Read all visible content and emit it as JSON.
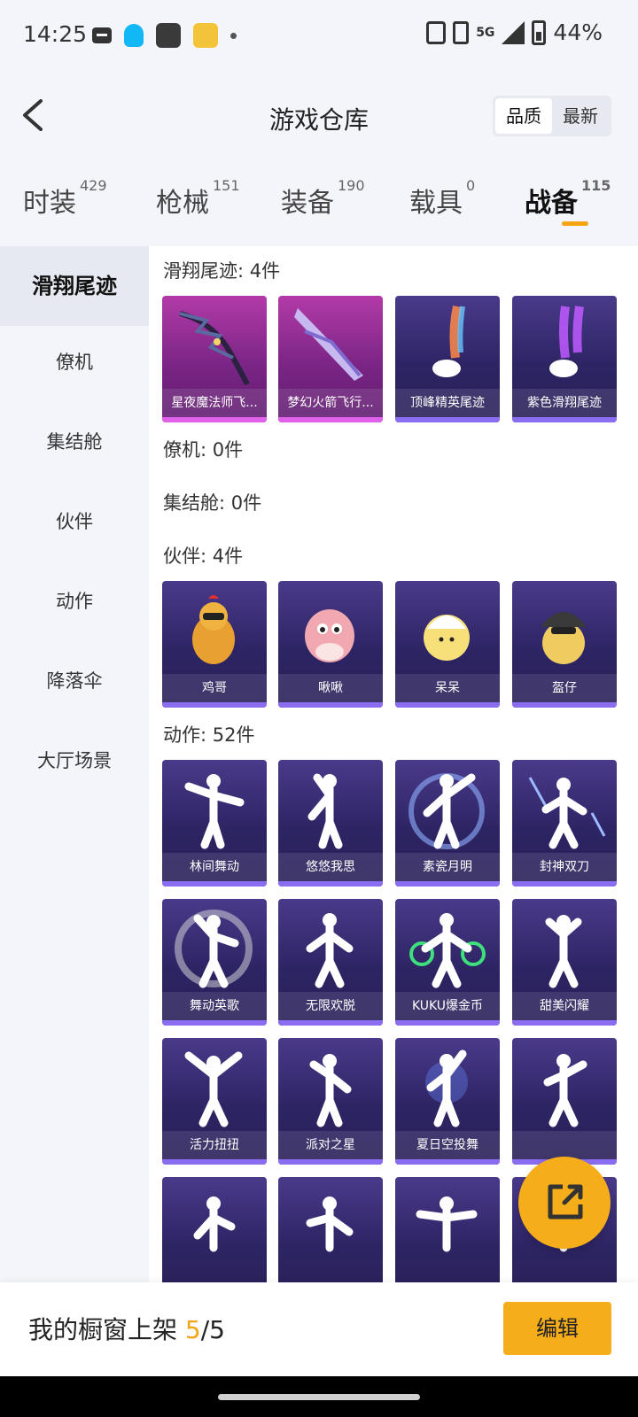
{
  "status_bar": {
    "time": "14:25",
    "network": "5G",
    "battery": "44%"
  },
  "header": {
    "title": "游戏仓库",
    "sort_options": [
      "品质",
      "最新"
    ],
    "active_sort": "品质"
  },
  "tabs": [
    {
      "label": "时装",
      "count": "429"
    },
    {
      "label": "枪械",
      "count": "151"
    },
    {
      "label": "装备",
      "count": "190"
    },
    {
      "label": "载具",
      "count": "0"
    },
    {
      "label": "战备",
      "count": "115",
      "active": true
    }
  ],
  "sidebar": {
    "items": [
      {
        "label": "滑翔尾迹",
        "active": true
      },
      {
        "label": "僚机"
      },
      {
        "label": "集结舱"
      },
      {
        "label": "伙伴"
      },
      {
        "label": "动作"
      },
      {
        "label": "降落伞"
      },
      {
        "label": "大厅场景"
      }
    ]
  },
  "sections": [
    {
      "title": "滑翔尾迹: 4件",
      "items": [
        "星夜魔法师飞...",
        "梦幻火箭飞行...",
        "顶峰精英尾迹",
        "紫色滑翔尾迹"
      ]
    },
    {
      "title": "僚机: 0件",
      "items": []
    },
    {
      "title": "集结舱: 0件",
      "items": []
    },
    {
      "title": "伙伴: 4件",
      "items": [
        "鸡哥",
        "啾啾",
        "呆呆",
        "盔仔"
      ]
    },
    {
      "title": "动作: 52件",
      "items": [
        "林间舞动",
        "悠悠我思",
        "素瓷月明",
        "封神双刀",
        "舞动英歌",
        "无限欢脱",
        "KUKU爆金币",
        "甜美闪耀",
        "活力扭扭",
        "派对之星",
        "夏日空投舞",
        "",
        "",
        "",
        "",
        ""
      ]
    }
  ],
  "bottom_bar": {
    "label_prefix": "我的橱窗上架 ",
    "shelf_used": "5",
    "shelf_total": "/5",
    "edit_label": "编辑"
  },
  "colors": {
    "accent": "#f5a412",
    "card_bg": "#2d2464",
    "card_magic_bg": "#7a2585"
  }
}
